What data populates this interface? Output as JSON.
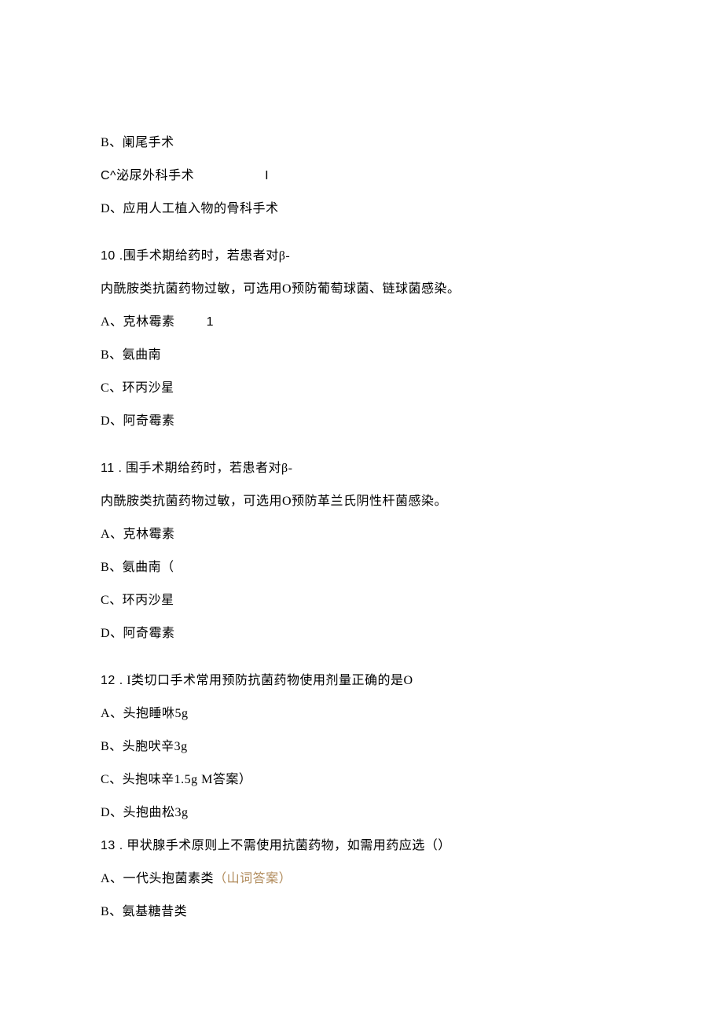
{
  "q9_continued": {
    "optB": "B、阑尾手术",
    "optC_prefix": "C^",
    "optC_text": "泌尿外科手术",
    "optC_mark": "I",
    "optD": "D、应用人工植入物的骨科手术"
  },
  "q10": {
    "number": "10 .",
    "stem1": "围手术期给药时，若患者对β-",
    "stem2": "内酰胺类抗菌药物过敏，可选用O预防葡萄球菌、链球菌感染。",
    "optA": "A、克林霉素",
    "optA_mark": "1",
    "optB": "B、氨曲南",
    "optC": "C、环丙沙星",
    "optD": "D、阿奇霉素"
  },
  "q11": {
    "number": "11 .",
    "stem1": " 围手术期给药时，若患者对β-",
    "stem2": "内酰胺类抗菌药物过敏，可选用O预防革兰氏阴性杆菌感染。",
    "optA": "A、克林霉素",
    "optB": "B、氨曲南（",
    "optC": "C、环丙沙星",
    "optD": "D、阿奇霉素"
  },
  "q12": {
    "number": "12 .",
    "stem": " I类切口手术常用预防抗菌药物使用剂量正确的是O",
    "optA": "A、头抱睡咻5g",
    "optB": "B、头胞吠辛3g",
    "optC": "C、头抱味辛1.5g M答案）",
    "optD": "D、头抱曲松3g"
  },
  "q13": {
    "number": "13 .",
    "stem": " 甲状腺手术原则上不需使用抗菌药物，如需用药应选（）",
    "optA": "A、一代头抱菌素类",
    "optA_note": "（山词答案）",
    "optB": "B、氨基糖昔类"
  }
}
